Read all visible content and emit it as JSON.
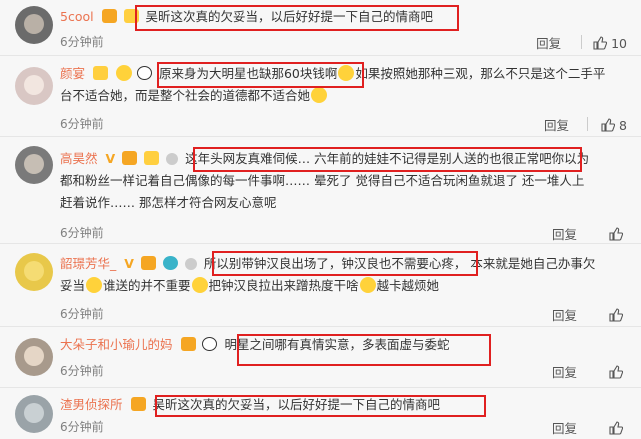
{
  "comments": [
    {
      "username": "5cool",
      "text": "吴昕这次真的欠妥当，以后好好提一下自己的情商吧",
      "time": "6分钟前",
      "reply_label": "回复",
      "likes": "10",
      "avatar_color": "#6b6b6b"
    },
    {
      "username": "颜宴",
      "text_a": "原来身为大明星也缺那60块钱啊",
      "text_b": "如果按照她那种三观，那么不只是这个二手平",
      "text_c": "台不适合她，而是整个社会的道德都不适合她",
      "time": "6分钟前",
      "reply_label": "回复",
      "likes": "8",
      "avatar_color": "#d9c7c4"
    },
    {
      "username": "高昊然",
      "vip_mark": "V",
      "text_a": "这年头网友真难伺候… 六年前的娃娃不记得是别人送的也很正常吧",
      "text_b": "你以为",
      "text_c": "都和粉丝一样记着自己偶像的每一件事啊…… 晕死了 觉得自己不适合玩闲鱼就退了 还一堆人上",
      "text_d": "赶着说作…… 那怎样才符合网友心意呢",
      "time": "6分钟前",
      "reply_label": "回复",
      "likes": "",
      "avatar_color": "#7a7a7a"
    },
    {
      "username": "韶璟芳华_",
      "vip_mark": "V",
      "text_a": "所以别带钟汉良出场了，钟汉良也不需要心疼，",
      "text_b": "本来就是她自己办事欠",
      "text_c": "妥当",
      "text_d": "谁送的并不重要",
      "text_e": "把钟汉良拉出来蹭热度干啥",
      "text_f": "越卡越烦她",
      "time": "6分钟前",
      "reply_label": "回复",
      "likes": "",
      "avatar_color": "#e8c84a"
    },
    {
      "username": "大朵子和小瑜儿的妈",
      "text": "明星之间哪有真情实意，多表面虚与委蛇",
      "time": "6分钟前",
      "reply_label": "回复",
      "likes": "",
      "avatar_color": "#a89a8c"
    },
    {
      "username": "渣男侦探所",
      "text": "吴昕这次真的欠妥当，以后好好提一下自己的情商吧",
      "time": "6分钟前",
      "reply_label": "回复",
      "likes": "",
      "avatar_color": "#9aa3a8"
    }
  ],
  "colors": {
    "username": "#eb7350",
    "highlight": "#e02020",
    "meta": "#808080"
  }
}
